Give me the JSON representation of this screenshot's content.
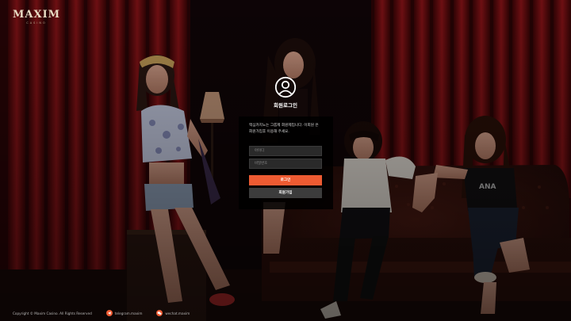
{
  "brand": {
    "logo_text": "MAXIM",
    "logo_subtext": "CASINO"
  },
  "login": {
    "title": "회원로그인",
    "notice": "맥심카지노는 그룹제 회원제입니다. 이회원 은 회원가입후 이용해 주세요.",
    "username_placeholder": "아이디",
    "password_placeholder": "비밀번호",
    "login_button": "로그인",
    "signup_button": "회원가입"
  },
  "footer": {
    "copyright": "Copyright © Maxim Casino. All Rights Reserved",
    "telegram": "telegram.maxim",
    "wechat": "wechat.maxim"
  },
  "colors": {
    "accent": "#ee5b32",
    "panel_background": "#000000",
    "curtain_red": "#8e1418"
  },
  "icons": {
    "user": "user-circle-icon",
    "telegram": "telegram-icon",
    "wechat": "wechat-icon"
  }
}
